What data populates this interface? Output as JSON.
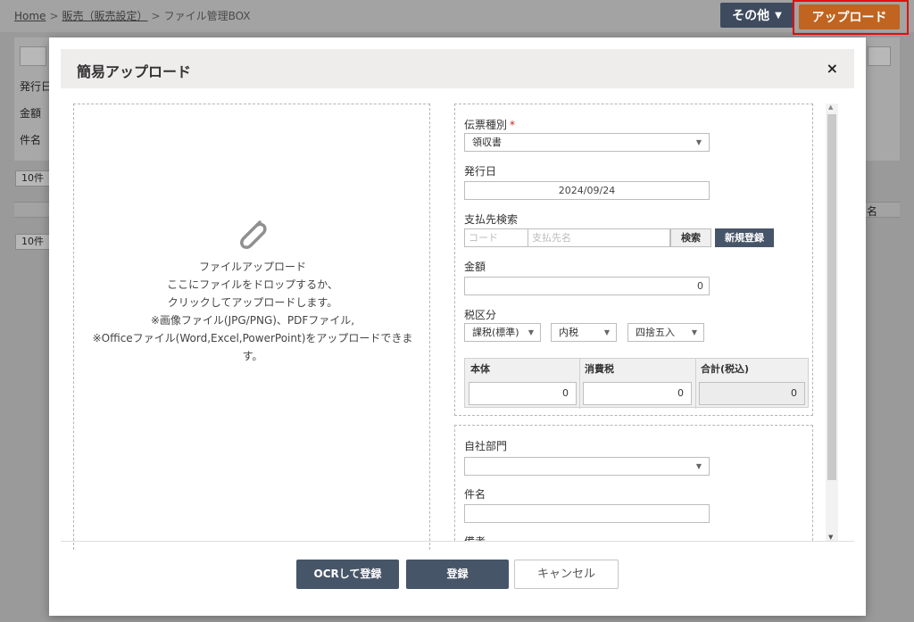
{
  "breadcrumb": {
    "home": "Home",
    "sep1": ">",
    "sales": "販売（販売設定）",
    "sep2": ">",
    "current": "ファイル管理BOX"
  },
  "topbar": {
    "other_label": "その他",
    "other_caret": "▼",
    "upload_label": "アップロード"
  },
  "background": {
    "label_issue_date": "発行日",
    "label_amount": "金額",
    "label_subject": "件名",
    "page_size_top": "10件",
    "page_size_bottom": "10件",
    "col_name_fragment": "名"
  },
  "modal": {
    "title": "簡易アップロード",
    "close": "×",
    "dropzone": {
      "lines": [
        "ファイルアップロード",
        "ここにファイルをドロップするか、",
        "クリックしてアップロードします。",
        "※画像ファイル(JPG/PNG)、PDFファイル,",
        "※Officeファイル(Word,Excel,PowerPoint)をアップロードできま",
        "す。"
      ]
    },
    "form": {
      "voucher_type_label": "伝票種別",
      "required_mark": "*",
      "voucher_type_value": "領収書",
      "issue_date_label": "発行日",
      "issue_date_value": "2024/09/24",
      "payee_search_label": "支払先検索",
      "code_placeholder": "コード",
      "payee_name_placeholder": "支払先名",
      "search_button": "検索",
      "new_register_button": "新規登録",
      "amount_label": "金額",
      "amount_value": "0",
      "tax_category_label": "税区分",
      "tax_type_value": "課税(標準)",
      "tax_incl_value": "内税",
      "rounding_value": "四捨五入",
      "table": {
        "headers": [
          "本体",
          "消費税",
          "合計(税込)"
        ],
        "values": [
          "0",
          "0",
          "0"
        ]
      },
      "department_label": "自社部門",
      "department_value": "",
      "subject_label": "件名",
      "subject_value": "",
      "remarks_label": "備考"
    },
    "buttons": {
      "ocr": "OCRして登録",
      "register": "登録",
      "cancel": "キャンセル"
    }
  },
  "icons": {
    "dropdown_arrow": "▼",
    "scroll_up": "▲",
    "scroll_down": "▼"
  }
}
